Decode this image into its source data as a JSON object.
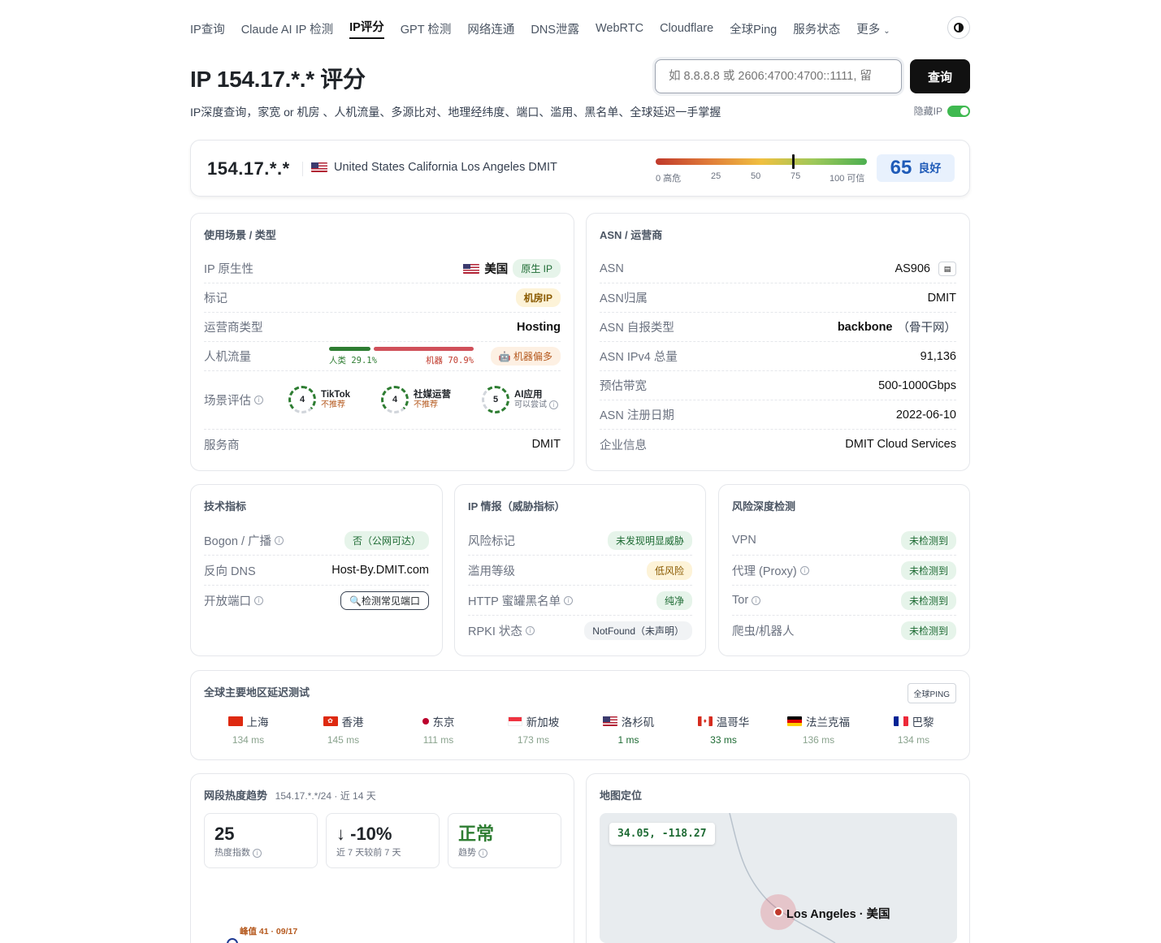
{
  "nav": {
    "items": [
      "IP查询",
      "Claude AI IP 检测",
      "IP评分",
      "GPT 检测",
      "网络连通",
      "DNS泄露",
      "WebRTC",
      "Cloudflare",
      "全球Ping",
      "服务状态",
      "更多"
    ],
    "active": "IP评分"
  },
  "header": {
    "title": "IP 154.17.*.* 评分",
    "search_placeholder": "如 8.8.8.8 或 2606:4700:4700::1111, 留",
    "query_button": "查询",
    "subtitle": "IP深度查询，家宽 or 机房 、人机流量、多源比对、地理经纬度、端口、滥用、黑名单、全球延迟一手掌握",
    "hide_ip_label": "隐藏IP",
    "hide_ip_on": true
  },
  "score": {
    "ip": "154.17.*.*",
    "location": "United States California Los Angeles DMIT",
    "gauge_labels": [
      "0 高危",
      "25",
      "50",
      "75",
      "100 可信"
    ],
    "value": 65,
    "value_text": "65",
    "rating": "良好"
  },
  "usage": {
    "title": "使用场景 / 类型",
    "native_label": "IP 原生性",
    "native_country": "美国",
    "native_badge": "原生 IP",
    "tag_label": "标记",
    "tag_badge": "机房IP",
    "isp_type_label": "运营商类型",
    "isp_type": "Hosting",
    "traffic_label": "人机流量",
    "human_text": "人类 29.1%",
    "bot_text": "机器 70.9%",
    "human_pct": 29.1,
    "bot_pct": 70.9,
    "traffic_badge": "机器偏多",
    "scene_label": "场景评估",
    "scenes": [
      {
        "score": "4",
        "name": "TikTok",
        "note": "不推荐"
      },
      {
        "score": "4",
        "name": "社媒运营",
        "note": "不推荐"
      },
      {
        "score": "5",
        "name": "AI应用",
        "note": "可以尝试"
      }
    ],
    "provider_label": "服务商",
    "provider": "DMIT"
  },
  "asn": {
    "title": "ASN / 运营商",
    "rows": [
      {
        "k": "ASN",
        "v": "AS906"
      },
      {
        "k": "ASN归属",
        "v": "DMIT"
      },
      {
        "k": "ASN 自报类型",
        "v": "backbone",
        "v2": "（骨干网）"
      },
      {
        "k": "ASN IPv4 总量",
        "v": "91,136"
      },
      {
        "k": "预估带宽",
        "v": "500-1000Gbps"
      },
      {
        "k": "ASN 注册日期",
        "v": "2022-06-10"
      },
      {
        "k": "企业信息",
        "v": "DMIT Cloud Services"
      }
    ]
  },
  "tech": {
    "title": "技术指标",
    "bogon_label": "Bogon / 广播",
    "bogon_value": "否（公网可达）",
    "rdns_label": "反向 DNS",
    "rdns_value": "Host-By.DMIT.com",
    "ports_label": "开放端口",
    "ports_button": "检测常见端口"
  },
  "intel": {
    "title": "IP 情报（威胁指标）",
    "rows": [
      {
        "k": "风险标记",
        "v": "未发现明显威胁",
        "info": false
      },
      {
        "k": "滥用等级",
        "v": "低风险",
        "info": false
      },
      {
        "k": "HTTP 蜜罐黑名单",
        "v": "纯净",
        "info": true
      },
      {
        "k": "RPKI 状态",
        "v": "NotFound（未声明）",
        "info": true
      }
    ]
  },
  "risk": {
    "title": "风险深度检测",
    "rows": [
      {
        "k": "VPN",
        "v": "未检测到",
        "info": false
      },
      {
        "k": "代理 (Proxy)",
        "v": "未检测到",
        "info": true
      },
      {
        "k": "Tor",
        "v": "未检测到",
        "info": true
      },
      {
        "k": "爬虫/机器人",
        "v": "未检测到",
        "info": false
      }
    ]
  },
  "latency": {
    "title": "全球主要地区延迟测试",
    "button": "全球PING",
    "items": [
      {
        "city": "上海",
        "ms": "134 ms"
      },
      {
        "city": "香港",
        "ms": "145 ms"
      },
      {
        "city": "东京",
        "ms": "111 ms"
      },
      {
        "city": "新加坡",
        "ms": "173 ms"
      },
      {
        "city": "洛杉矶",
        "ms": "1 ms"
      },
      {
        "city": "温哥华",
        "ms": "33 ms"
      },
      {
        "city": "法兰克福",
        "ms": "136 ms"
      },
      {
        "city": "巴黎",
        "ms": "134 ms"
      }
    ]
  },
  "trend": {
    "title": "网段热度趋势",
    "subtitle": "154.17.*.*/24 · 近 14 天",
    "stats": [
      {
        "value": "25",
        "label": "热度指数"
      },
      {
        "value": "-10%",
        "label": "近 7 天较前 7 天"
      },
      {
        "value": "正常",
        "label": "趋势"
      }
    ],
    "peak": "峰值 41 · 09/17"
  },
  "mapcard": {
    "title": "地图定位",
    "coords": "34.05, -118.27",
    "place": "Los Angeles · 美国"
  }
}
